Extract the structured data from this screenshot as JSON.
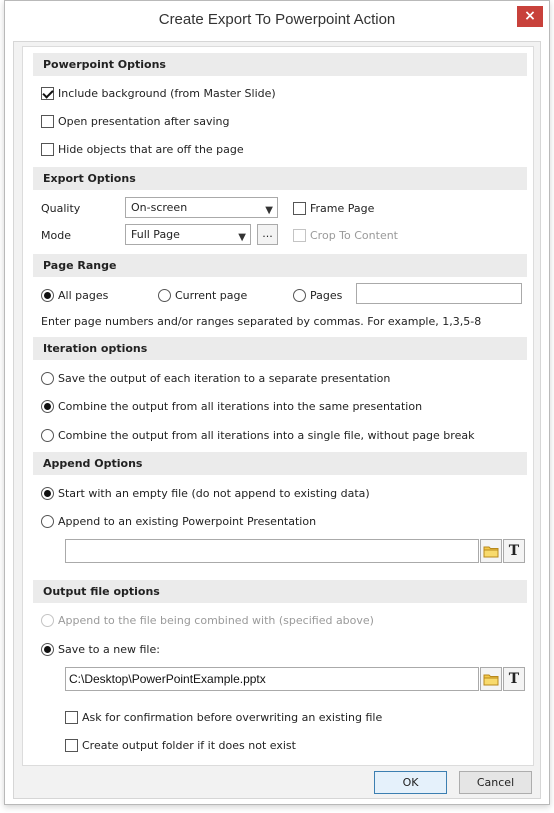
{
  "window": {
    "title": "Create Export To Powerpoint Action",
    "close_glyph": "×"
  },
  "powerpoint_options": {
    "header": "Powerpoint Options",
    "include_background": {
      "label": "Include background (from Master Slide)",
      "checked": true
    },
    "open_after_saving": {
      "label": "Open presentation after saving",
      "checked": false
    },
    "hide_offpage": {
      "label": "Hide objects that are off the page",
      "checked": false
    }
  },
  "export_options": {
    "header": "Export Options",
    "quality_label": "Quality",
    "quality_value": "On-screen",
    "mode_label": "Mode",
    "mode_value": "Full Page",
    "more_button": "...",
    "frame_page": {
      "label": "Frame Page",
      "checked": false
    },
    "crop_to_content": {
      "label": "Crop To Content",
      "checked": false,
      "disabled": true
    }
  },
  "page_range": {
    "header": "Page Range",
    "all_pages": "All pages",
    "current_page": "Current page",
    "pages": "Pages",
    "pages_value": "",
    "selected": "all_pages",
    "hint": "Enter page numbers and/or ranges separated by commas. For example, 1,3,5-8"
  },
  "iteration_options": {
    "header": "Iteration options",
    "opt1": "Save the output of each iteration to a separate presentation",
    "opt2": "Combine the output from all iterations into the same presentation",
    "opt3": "Combine the output from all iterations into a single file, without page break",
    "selected": "opt2"
  },
  "append_options": {
    "header": "Append Options",
    "opt1": "Start with an empty file (do not append to existing data)",
    "opt2": "Append to an existing Powerpoint Presentation",
    "selected": "opt1",
    "path_value": ""
  },
  "output_file_options": {
    "header": "Output file options",
    "append_combined": "Append to the file being combined with (specified above)",
    "save_new": "Save to a new file:",
    "selected": "save_new",
    "path_value": "C:\\Desktop\\PowerPointExample.pptx",
    "ask_confirmation": {
      "label": "Ask for confirmation before overwriting an existing file",
      "checked": false
    },
    "create_folder": {
      "label": "Create output folder if it does not exist",
      "checked": false
    }
  },
  "footer": {
    "ok": "OK",
    "cancel": "Cancel"
  },
  "icons": {
    "folder": "folder-icon",
    "template": "text-template-icon"
  },
  "colors": {
    "close": "#c8413b",
    "header_bg": "#ebebeb",
    "ok_border": "#3c7fb1"
  }
}
